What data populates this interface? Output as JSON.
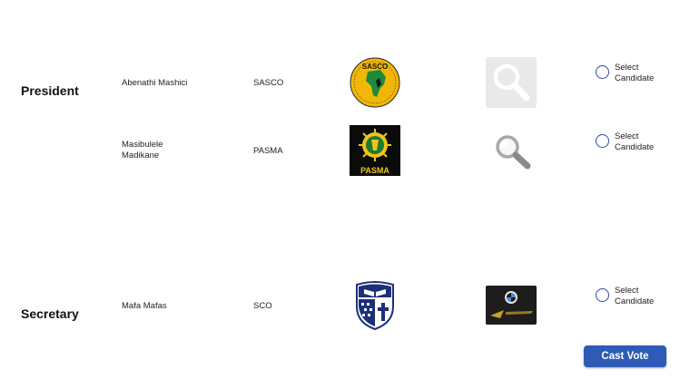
{
  "positions": [
    {
      "title": "President",
      "candidates": [
        {
          "name": "Abenathi Mashici",
          "party": "SASCO",
          "logo_icon": "sasco-logo-icon",
          "logo_text": "SASCO",
          "photo_icon": "magnifier-placeholder-icon",
          "select_label": "Select Candidate"
        },
        {
          "name": "Masibulele Madikane",
          "party": "PASMA",
          "logo_icon": "pasma-logo-icon",
          "logo_text": "PASMA",
          "photo_icon": "magnifier-placeholder-icon",
          "select_label": "Select Candidate"
        }
      ]
    },
    {
      "title": "Secretary",
      "candidates": [
        {
          "name": "Mafa Mafas",
          "party": "SCO",
          "logo_icon": "sco-crest-logo-icon",
          "logo_text": "",
          "photo_icon": "car-photo-icon",
          "select_label": "Select Candidate"
        }
      ]
    }
  ],
  "cast_vote_label": "Cast Vote",
  "colors": {
    "accent": "#2f5bb7",
    "radio_border": "#2b4fa8"
  }
}
